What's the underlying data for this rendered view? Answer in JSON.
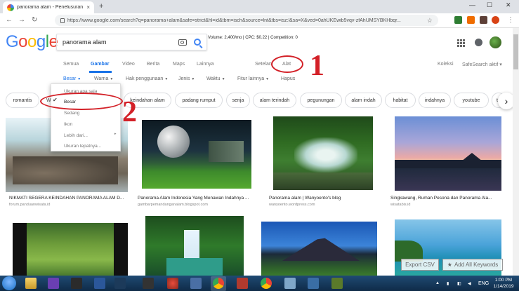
{
  "browser": {
    "tab_title": "panorama alam - Penelusuran G",
    "tab_close": "×",
    "new_tab": "+",
    "url": "https://www.google.com/search?q=panorama+alam&safe=strict&hl=id&tbm=isch&source=lnt&tbs=isz:l&sa=X&ved=0ahUKEwib5vqv-zfAhUMSYBKHbqr...",
    "back": "←",
    "forward": "→",
    "reload": "↻",
    "minimize": "—",
    "maximize": "☐",
    "close": "✕",
    "menu": "⋮"
  },
  "google": {
    "logo": [
      "G",
      "o",
      "o",
      "g",
      "l",
      "e"
    ],
    "logo_colors": [
      "#4285f4",
      "#ea4335",
      "#fbbc05",
      "#4285f4",
      "#34a853",
      "#ea4335"
    ],
    "query": "panorama alam",
    "seo_info": "Volume: 2,400/mo | CPC: $0.22 | Competition: 0",
    "tabs": [
      "Semua",
      "Gambar",
      "Video",
      "Berita",
      "Maps",
      "Lainnya"
    ],
    "settings": "Setelan",
    "tools": "Alat",
    "collections": "Koleksi",
    "safesearch": "SafeSearch aktif ▾"
  },
  "tool_filters": [
    "Besar",
    "Warna",
    "Hak penggunaan",
    "Jenis",
    "Waktu",
    "Fitur lainnya",
    "Hapus"
  ],
  "chips": [
    "romantis",
    "keindahan alam",
    "padang rumput",
    "senja",
    "alam terindah",
    "pegunungan",
    "alam indah",
    "habitat",
    "indahnya",
    "youtube",
    "tu"
  ],
  "dropdown": {
    "items": [
      "Ukuran apa saja",
      "Besar",
      "Sedang",
      "Ikon",
      "Lebih dari...",
      "Ukuran tepatnya..."
    ],
    "selected_prefix": "W",
    "check": "✔",
    "arrow": "▸"
  },
  "annotations": {
    "one": "1",
    "two": "2",
    "color": "#d32027"
  },
  "images": [
    {
      "caption": "NIKMATI SEGERA KEINDAHAN PANORAMA ALAM D...",
      "source": "forum.panduanwisata.id"
    },
    {
      "caption": "Panorama Alam Indonesia Yang Menawan Indahnya ...",
      "source": "gambarpemandanganalam.blogspot.com"
    },
    {
      "caption": "Panorama alam | Wanyoento's blog",
      "source": "wanyoento.wordpress.com"
    },
    {
      "caption": "Singkawang, Ruman Pesona dan Panorama Ala...",
      "source": "wisatabis.id"
    }
  ],
  "overlay": {
    "export": "Export CSV",
    "add_keywords": "Add All Keywords",
    "star": "★"
  },
  "taskbar": {
    "lang": "ENG",
    "time": "1:00 PM",
    "date": "1/14/2019"
  }
}
